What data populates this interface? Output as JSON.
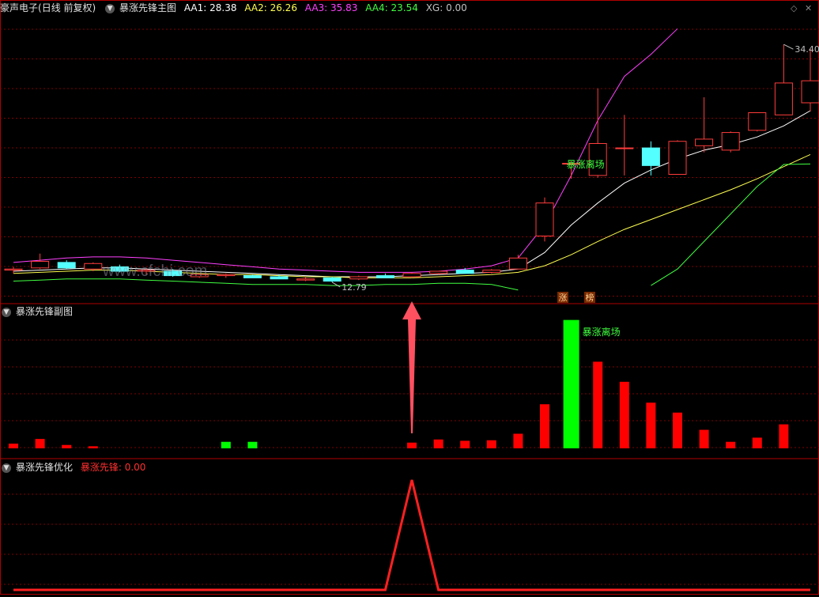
{
  "main_panel": {
    "title": "豪声电子",
    "period": "(日线 前复权)",
    "indicator": "暴涨先锋主图",
    "aa1_label": "AA1:",
    "aa1_value": "28.38",
    "aa2_label": "AA2:",
    "aa2_value": "26.26",
    "aa3_label": "AA3:",
    "aa3_value": "35.83",
    "aa4_label": "AA4:",
    "aa4_value": "23.54",
    "xg_label": "XG:",
    "xg_value": "0.00",
    "high_label": "34.40",
    "low_label": "12.79",
    "signal_text": "暴涨离场",
    "badge_zhang": "涨",
    "badge_bang": "榜"
  },
  "sub_panel": {
    "title": "暴涨先锋副图",
    "signal_text": "暴涨离场"
  },
  "bottom_panel": {
    "title": "暴涨先锋优化",
    "series_label": "暴涨先锋:",
    "series_value": "0.00"
  },
  "watermark": "www.cfchi.com",
  "colors": {
    "up": "#ff3c3c",
    "down": "#54ffff",
    "aa1": "#ffffff",
    "aa2": "#ffff50",
    "aa3": "#ff40ff",
    "aa4": "#40ff40",
    "grid": "#800000",
    "sep": "#b00000",
    "bar_green": "#00ff00",
    "bar_red": "#ff0000"
  },
  "chart_data": [
    {
      "type": "candlestick",
      "title": "暴涨先锋主图",
      "ylim": [
        11,
        37
      ],
      "candles": [
        {
          "o": 13.9,
          "h": 14.2,
          "l": 13.6,
          "c": 14.0
        },
        {
          "o": 14.1,
          "h": 15.4,
          "l": 14.0,
          "c": 14.7
        },
        {
          "o": 14.6,
          "h": 14.8,
          "l": 14.0,
          "c": 14.1
        },
        {
          "o": 14.0,
          "h": 14.6,
          "l": 13.8,
          "c": 14.5
        },
        {
          "o": 14.2,
          "h": 14.4,
          "l": 13.7,
          "c": 13.8
        },
        {
          "o": 13.8,
          "h": 14.1,
          "l": 13.5,
          "c": 13.9
        },
        {
          "o": 13.8,
          "h": 14.0,
          "l": 13.3,
          "c": 13.4
        },
        {
          "o": 13.3,
          "h": 13.6,
          "l": 13.2,
          "c": 13.5
        },
        {
          "o": 13.4,
          "h": 13.6,
          "l": 13.2,
          "c": 13.5
        },
        {
          "o": 13.4,
          "h": 13.5,
          "l": 13.2,
          "c": 13.2
        },
        {
          "o": 13.3,
          "h": 13.5,
          "l": 13.1,
          "c": 13.1
        },
        {
          "o": 13.0,
          "h": 13.3,
          "l": 12.9,
          "c": 13.1
        },
        {
          "o": 13.2,
          "h": 13.3,
          "l": 12.8,
          "c": 12.9
        },
        {
          "o": 13.1,
          "h": 13.4,
          "l": 13.0,
          "c": 13.3
        },
        {
          "o": 13.4,
          "h": 13.6,
          "l": 13.2,
          "c": 13.2
        },
        {
          "o": 13.3,
          "h": 13.7,
          "l": 13.2,
          "c": 13.6
        },
        {
          "o": 13.6,
          "h": 13.8,
          "l": 13.5,
          "c": 13.8
        },
        {
          "o": 13.9,
          "h": 14.1,
          "l": 13.6,
          "c": 13.6
        },
        {
          "o": 13.7,
          "h": 14.0,
          "l": 13.6,
          "c": 13.9
        },
        {
          "o": 14.0,
          "h": 15.3,
          "l": 14.0,
          "c": 15.0
        },
        {
          "o": 17.0,
          "h": 20.5,
          "l": 16.5,
          "c": 20.0
        },
        {
          "o": 23.6,
          "h": 23.8,
          "l": 22.2,
          "c": 23.6
        },
        {
          "o": 22.5,
          "h": 30.4,
          "l": 22.3,
          "c": 25.4
        },
        {
          "o": 25.0,
          "h": 28.0,
          "l": 22.5,
          "c": 25.0
        },
        {
          "o": 25.0,
          "h": 25.6,
          "l": 22.5,
          "c": 23.4
        },
        {
          "o": 22.6,
          "h": 25.7,
          "l": 22.6,
          "c": 25.6
        },
        {
          "o": 25.2,
          "h": 29.6,
          "l": 24.6,
          "c": 25.8
        },
        {
          "o": 24.8,
          "h": 26.5,
          "l": 24.6,
          "c": 26.4
        },
        {
          "o": 26.6,
          "h": 28.2,
          "l": 26.5,
          "c": 28.2
        },
        {
          "o": 28.0,
          "h": 34.4,
          "l": 28.0,
          "c": 30.9
        },
        {
          "o": 29.1,
          "h": 34.0,
          "l": 28.3,
          "c": 31.1
        }
      ],
      "series": [
        {
          "name": "AA1",
          "values": [
            13.8,
            13.9,
            14.0,
            14.1,
            14.1,
            14.0,
            13.9,
            13.8,
            13.7,
            13.6,
            13.5,
            13.4,
            13.3,
            13.3,
            13.3,
            13.4,
            13.5,
            13.6,
            13.7,
            14.0,
            15.5,
            18.0,
            20.0,
            21.8,
            23.0,
            24.0,
            24.8,
            25.3,
            26.0,
            27.0,
            28.38
          ]
        },
        {
          "name": "AA2",
          "values": [
            13.6,
            13.7,
            13.8,
            13.9,
            13.9,
            13.8,
            13.7,
            13.6,
            13.5,
            13.5,
            13.4,
            13.3,
            13.3,
            13.2,
            13.2,
            13.2,
            13.3,
            13.4,
            13.5,
            13.7,
            14.3,
            15.3,
            16.5,
            17.6,
            18.5,
            19.4,
            20.3,
            21.2,
            22.2,
            23.3,
            24.4
          ]
        },
        {
          "name": "AA3",
          "values": [
            14.6,
            14.8,
            15.0,
            15.1,
            15.1,
            15.0,
            14.8,
            14.6,
            14.4,
            14.2,
            14.0,
            13.9,
            13.8,
            13.7,
            13.7,
            13.7,
            13.8,
            14.0,
            14.3,
            15.0,
            18.0,
            22.5,
            27.5,
            31.5,
            33.5,
            35.83
          ]
        },
        {
          "name": "AA4",
          "values": [
            12.9,
            13.0,
            13.1,
            13.1,
            13.1,
            13.0,
            12.9,
            12.8,
            12.7,
            12.6,
            12.6,
            12.6,
            12.5,
            12.5,
            12.6,
            12.6,
            12.7,
            12.7,
            12.6,
            12.1,
            null,
            null,
            null,
            null,
            12.5,
            14.0,
            16.5,
            19.0,
            21.5,
            23.5,
            23.54
          ]
        }
      ]
    },
    {
      "type": "bar",
      "title": "暴涨先锋副图",
      "ylim": [
        0,
        50
      ],
      "values": [
        1.8,
        3.6,
        1.3,
        0.8,
        null,
        null,
        null,
        null,
        2.5,
        2.5,
        null,
        null,
        null,
        null,
        null,
        2.2,
        3.4,
        2.9,
        3.1,
        5.6,
        16.9,
        49.2,
        33.2,
        25.5,
        17.5,
        13.7,
        7.1,
        2.5,
        4.1,
        9.2
      ],
      "colors": [
        "red",
        "red",
        "red",
        "red",
        null,
        null,
        null,
        null,
        "green",
        "green",
        null,
        null,
        null,
        null,
        null,
        "red",
        "red",
        "red",
        "red",
        "red",
        "red",
        "green",
        "red",
        "red",
        "red",
        "red",
        "red",
        "red",
        "red",
        "red"
      ]
    },
    {
      "type": "line",
      "title": "暴涨先锋优化",
      "series_name": "暴涨先锋",
      "ylim": [
        0,
        1.05
      ],
      "values": [
        0,
        0,
        0,
        0,
        0,
        0,
        0,
        0,
        0,
        0,
        0,
        0,
        0,
        0,
        0,
        1,
        0,
        0,
        0,
        0,
        0,
        0,
        0,
        0,
        0,
        0,
        0,
        0,
        0,
        0,
        0
      ]
    }
  ]
}
